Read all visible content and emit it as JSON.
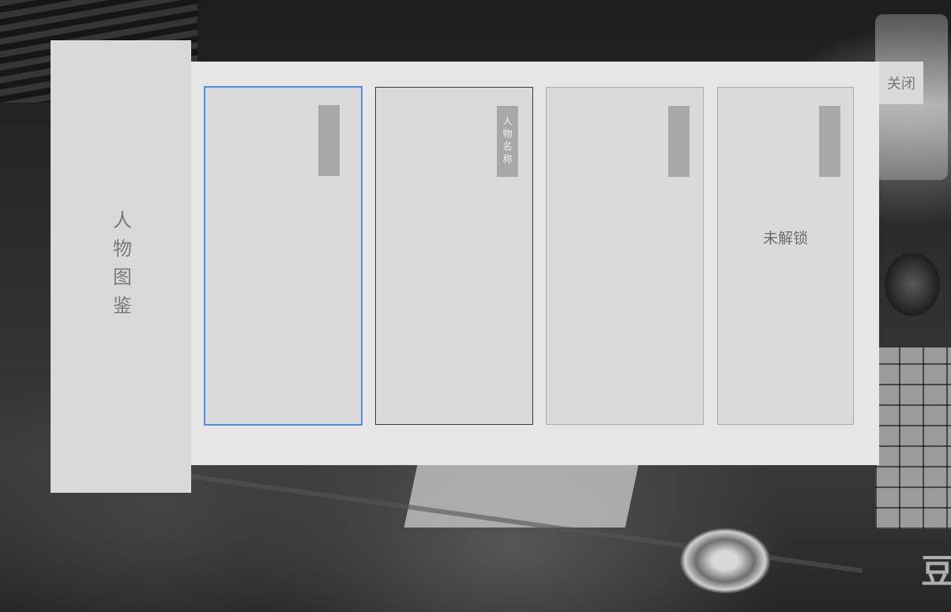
{
  "side_panel": {
    "title": "人物图鉴"
  },
  "close_button": {
    "label": "关闭"
  },
  "cards": [
    {
      "selected": true,
      "name": "",
      "locked": false
    },
    {
      "selected": false,
      "name": "人物名称",
      "locked": false
    },
    {
      "selected": false,
      "name": "",
      "locked": false
    },
    {
      "selected": false,
      "name": "",
      "locked": true,
      "locked_label": "未解锁"
    }
  ],
  "colors": {
    "selection_border": "#4e8ee4",
    "panel_background": "#e6e6e6",
    "card_background": "#dadada",
    "name_tag": "#a8a8a8"
  },
  "background": {
    "watermark_glyph": "豆"
  }
}
